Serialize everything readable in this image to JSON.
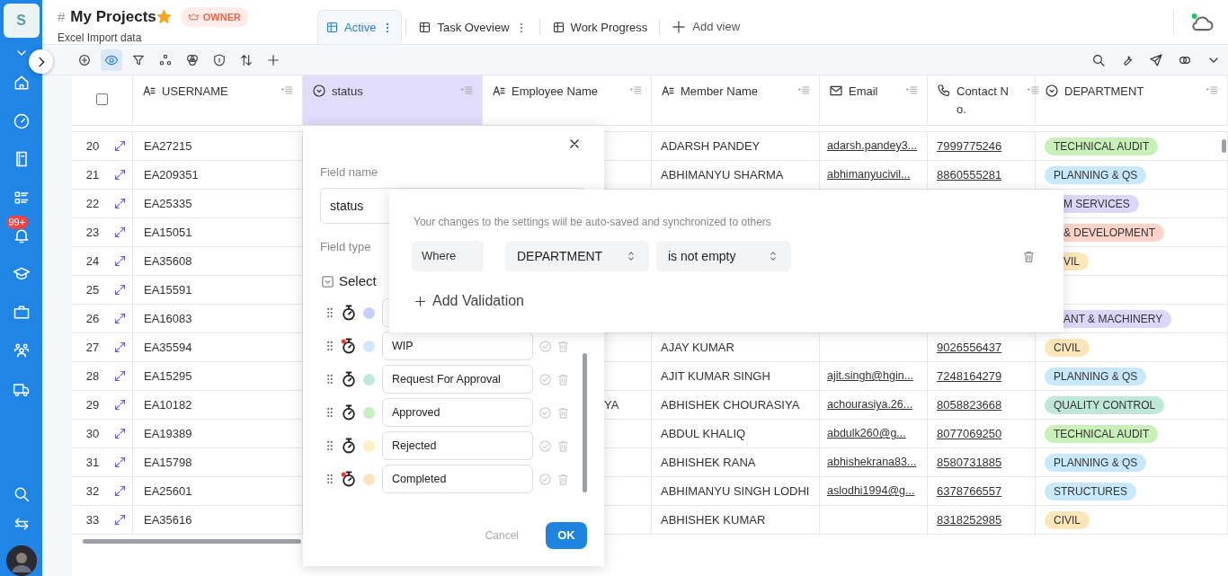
{
  "sidebar": {
    "logo": "S",
    "badge": "99+"
  },
  "header": {
    "hash": "#",
    "title": "My Projects",
    "role": "OWNER",
    "subtitle": "Excel Import data"
  },
  "tabs": [
    {
      "label": "Active",
      "selected": true,
      "menu": true
    },
    {
      "label": "Task Oveview",
      "selected": false,
      "menu": true
    },
    {
      "label": "Work Progress",
      "selected": false,
      "menu": false
    }
  ],
  "add_view": "Add view",
  "toolbar": {
    "left": [
      {
        "selected": false
      },
      {
        "selected": true
      },
      {
        "selected": false
      },
      {
        "selected": false
      },
      {
        "selected": false
      },
      {
        "selected": false
      },
      {
        "selected": false
      },
      {
        "selected": false
      }
    ]
  },
  "table": {
    "select_all_checked": false,
    "columns": [
      {
        "label": "USERNAME",
        "kind": "text",
        "highlighted": false
      },
      {
        "label": "status",
        "kind": "select",
        "highlighted": true
      },
      {
        "label": "Employee Name",
        "kind": "text",
        "highlighted": false
      },
      {
        "label": "Member Name",
        "kind": "text",
        "highlighted": false
      },
      {
        "label": "Email",
        "kind": "email",
        "highlighted": false
      },
      {
        "label": "Contact No.",
        "kind": "phone",
        "highlighted": false
      },
      {
        "label": "DEPARTMENT",
        "kind": "select",
        "highlighted": false
      }
    ],
    "rows": [
      {
        "number": "20",
        "username": "EA27215",
        "member_name": "ADARSH PANDEY",
        "email": "adarsh.pandey3...",
        "contact": "7999775246",
        "department": {
          "label": "TECHNICAL AUDIT",
          "color": "#c9f0b8",
          "clipped": false
        }
      },
      {
        "number": "21",
        "username": "EA209351",
        "member_name": "ABHIMANYU SHARMA",
        "email": "abhimanyucivil...",
        "contact": "8860555281",
        "department": {
          "label": "PLANNING & QS",
          "color": "#c8e9fb",
          "clipped": false
        }
      },
      {
        "number": "22",
        "username": "EA25335",
        "department": {
          "label": "M SERVICES",
          "color": "#ddd6fb",
          "clipped": true
        }
      },
      {
        "number": "23",
        "username": "EA15051",
        "department": {
          "label": "& DEVELOPMENT",
          "color": "#fcd3c8",
          "clipped": true
        }
      },
      {
        "number": "24",
        "username": "EA35608",
        "department": {
          "label": "VIL",
          "color": "#fde6b8",
          "clipped": true
        }
      },
      {
        "number": "25",
        "username": "EA15591"
      },
      {
        "number": "26",
        "username": "EA16083",
        "department": {
          "label": "ANT & MACHINERY",
          "color": "#ddd6fb",
          "clipped": true
        }
      },
      {
        "number": "27",
        "username": "EA35594",
        "member_name": "AJAY KUMAR",
        "contact": "9026556437",
        "department": {
          "label": "CIVIL",
          "color": "#fde6b8",
          "clipped": false
        }
      },
      {
        "number": "28",
        "username": "EA15295",
        "member_name": "AJIT KUMAR SINGH",
        "email": "ajit.singh@hgin...",
        "contact": "7248164279",
        "department": {
          "label": "PLANNING & QS",
          "color": "#c8e9fb",
          "clipped": false
        }
      },
      {
        "number": "29",
        "username": "EA10182",
        "employee_name": "YA",
        "member_name": "ABHISHEK CHOURASIYA",
        "email": "achourasiya.26...",
        "contact": "8058823668",
        "department": {
          "label": "QUALITY CONTROL",
          "color": "#bfe8d8",
          "clipped": false
        }
      },
      {
        "number": "30",
        "username": "EA19389",
        "member_name": "ABDUL KHALIQ",
        "email": "abdulk260@g...",
        "contact": "8077069250",
        "department": {
          "label": "TECHNICAL AUDIT",
          "color": "#c9f0b8",
          "clipped": false
        }
      },
      {
        "number": "31",
        "username": "EA15798",
        "member_name": "ABHISHEK RANA",
        "email": "abhishekrana83...",
        "contact": "8580731885",
        "department": {
          "label": "PLANNING & QS",
          "color": "#c8e9fb",
          "clipped": false
        }
      },
      {
        "number": "32",
        "username": "EA25601",
        "member_name": "ABHIMANYU SINGH LODHI",
        "email": "aslodhi1994@g...",
        "contact": "6378766557",
        "department": {
          "label": "STRUCTURES",
          "color": "#c8e9fb",
          "clipped": false
        }
      },
      {
        "number": "33",
        "username": "EA35616",
        "member_name": "ABHISHEK KUMAR",
        "contact": "8318252985",
        "department": {
          "label": "CIVIL",
          "color": "#fde6b8",
          "clipped": false
        }
      }
    ]
  },
  "dialog": {
    "field_name_label": "Field name",
    "field_name": "status",
    "field_type_label": "Field type",
    "field_type": "Select",
    "options": [
      {
        "color": "#c7d0fb",
        "flagged": false
      },
      {
        "label": "WIP",
        "color": "#cde9fb",
        "flagged": true
      },
      {
        "label": "Request For Approval",
        "color": "#bfe9dc",
        "flagged": false
      },
      {
        "label": "Approved",
        "color": "#c8efc0",
        "flagged": false
      },
      {
        "label": "Rejected",
        "color": "#fdf0c4",
        "flagged": false
      },
      {
        "label": "Completed",
        "color": "#fde3c0",
        "flagged": true
      }
    ],
    "cancel": "Cancel",
    "ok": "OK"
  },
  "validation": {
    "hint": "Your changes to the settings wiil be auto-saved and synchronized to others",
    "where": "Where",
    "field": "DEPARTMENT",
    "condition": "is not empty",
    "add": "Add Validation"
  }
}
